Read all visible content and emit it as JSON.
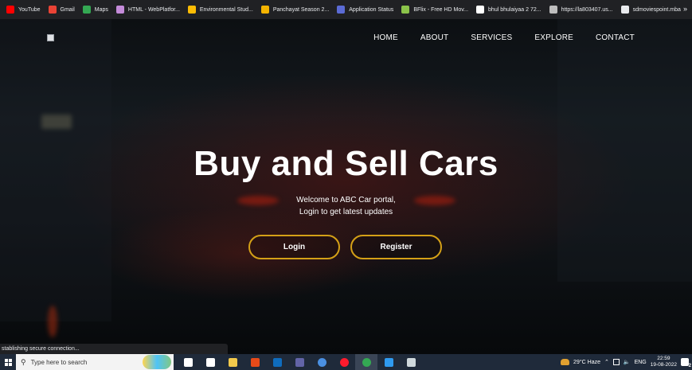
{
  "bookmarks": [
    {
      "label": "YouTube",
      "icon": "youtube-icon",
      "color": "#ff0000"
    },
    {
      "label": "Gmail",
      "icon": "gmail-icon",
      "color": "#ea4335"
    },
    {
      "label": "Maps",
      "icon": "maps-icon",
      "color": "#34a853"
    },
    {
      "label": "HTML - WebPlatfor...",
      "icon": "webplatform-icon",
      "color": "#c48bd9"
    },
    {
      "label": "Environmental Stud...",
      "icon": "drive-icon",
      "color": "#fbbc04"
    },
    {
      "label": "Panchayat Season 2...",
      "icon": "site-icon",
      "color": "#f4b400"
    },
    {
      "label": "Application Status",
      "icon": "status-icon",
      "color": "#5b6bd5"
    },
    {
      "label": "BFlix - Free HD Mov...",
      "icon": "bflix-icon",
      "color": "#8bc34a"
    },
    {
      "label": "bhul bhulaiyaa 2 72...",
      "icon": "google-icon",
      "color": "#ffffff"
    },
    {
      "label": "https://la803407.us...",
      "icon": "page-icon",
      "color": "#bdbdbd"
    },
    {
      "label": "sdmoviespoint.mba",
      "icon": "globe-icon",
      "color": "#e8eaed"
    }
  ],
  "bookmarks_more": "»",
  "nav": {
    "items": [
      "HOME",
      "ABOUT",
      "SERVICES",
      "EXPLORE",
      "CONTACT"
    ]
  },
  "hero": {
    "title": "Buy and Sell Cars",
    "subtitle_line1": "Welcome to ABC Car portal,",
    "subtitle_line2": "Login to get latest updates",
    "login_label": "Login",
    "register_label": "Register",
    "accent_color": "#d4a017"
  },
  "status_bar": {
    "text": "stablishing secure connection..."
  },
  "taskbar": {
    "search_placeholder": "Type here to search",
    "apps": [
      {
        "icon": "task-view-icon",
        "color": "#ffffff"
      },
      {
        "icon": "widgets-icon",
        "color": "#ffffff"
      },
      {
        "icon": "file-explorer-icon",
        "color": "#f2c94c"
      },
      {
        "icon": "office-icon",
        "color": "#e64a19"
      },
      {
        "icon": "outlook-icon",
        "color": "#0f6cbd"
      },
      {
        "icon": "teams-icon",
        "color": "#6264a7"
      },
      {
        "icon": "settings-app-icon",
        "color": "#4a90e2"
      },
      {
        "icon": "opera-icon",
        "color": "#ff1b2d"
      },
      {
        "icon": "chrome-icon",
        "color": "#34a853"
      },
      {
        "icon": "vscode-icon",
        "color": "#2f9bf0"
      },
      {
        "icon": "app-icon",
        "color": "#cfd8dc"
      }
    ],
    "weather": "29°C  Haze",
    "language": "ENG",
    "time": "22:59",
    "date": "19-08-2022",
    "notification_count": "2"
  }
}
